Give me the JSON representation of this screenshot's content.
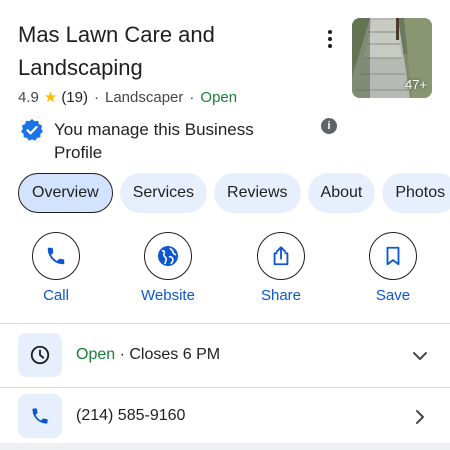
{
  "business": {
    "name": "Mas Lawn Care and Landscaping",
    "rating": "4.9",
    "review_count": "(19)",
    "category": "Landscaper",
    "status": "Open",
    "separator": "·",
    "photo_count": "47+"
  },
  "ownership": {
    "text": "You manage this Business Profile",
    "info_icon": "i"
  },
  "tabs": [
    {
      "label": "Overview",
      "active": true
    },
    {
      "label": "Services"
    },
    {
      "label": "Reviews"
    },
    {
      "label": "About"
    },
    {
      "label": "Photos"
    }
  ],
  "actions": {
    "call": "Call",
    "website": "Website",
    "share": "Share",
    "save": "Save"
  },
  "hours": {
    "status": "Open",
    "separator": "·",
    "detail": "Closes 6 PM"
  },
  "phone": {
    "number": "(214) 585-9160"
  },
  "colors": {
    "accent": "#0b57d0",
    "open_green": "#188038",
    "star": "#fbbc04",
    "chip_bg": "#e8effc"
  },
  "icons": [
    "more-vert-icon",
    "verified-badge-icon",
    "info-icon",
    "phone-icon",
    "globe-icon",
    "share-icon",
    "bookmark-icon",
    "clock-icon",
    "chevron-down-icon",
    "chevron-right-icon"
  ]
}
